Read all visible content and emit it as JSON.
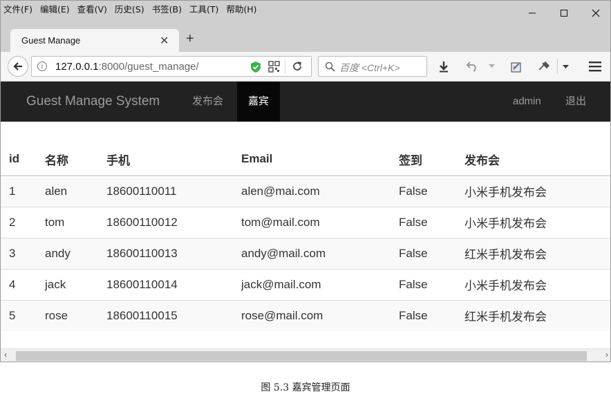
{
  "menubar": [
    "文件(F)",
    "编辑(E)",
    "查看(V)",
    "历史(S)",
    "书签(B)",
    "工具(T)",
    "帮助(H)"
  ],
  "tab": {
    "title": "Guest Manage",
    "close": "✕"
  },
  "newtab": "+",
  "address": {
    "host": "127.0.0.1",
    "port_path": ":8000/guest_manage/"
  },
  "search": {
    "placeholder": "百度 <Ctrl+K>"
  },
  "navbar": {
    "brand": "Guest Manage System",
    "links": [
      "发布会",
      "嘉宾"
    ],
    "active": "嘉宾",
    "user": "admin",
    "logout": "退出"
  },
  "table": {
    "headers": [
      "id",
      "名称",
      "手机",
      "Email",
      "签到",
      "发布会"
    ],
    "rows": [
      [
        "1",
        "alen",
        "18600110011",
        "alen@mai.com",
        "False",
        "小米手机发布会"
      ],
      [
        "2",
        "tom",
        "18600110012",
        "tom@mail.com",
        "False",
        "小米手机发布会"
      ],
      [
        "3",
        "andy",
        "18600110013",
        "andy@mail.com",
        "False",
        "红米手机发布会"
      ],
      [
        "4",
        "jack",
        "18600110014",
        "jack@mail.com",
        "False",
        "小米手机发布会"
      ],
      [
        "5",
        "rose",
        "18600110015",
        "rose@mail.com",
        "False",
        "红米手机发布会"
      ]
    ]
  },
  "caption": "图 5.3    嘉宾管理页面",
  "colors": {
    "navbar": "#222222",
    "active_bg": "#080808",
    "stripe": "#f9f9f9",
    "shield": "#3cb34a"
  },
  "icons": [
    "back-arrow-icon",
    "info-icon",
    "shield-icon",
    "qr-code-icon",
    "reload-icon",
    "search-icon",
    "download-icon",
    "undo-icon",
    "dropdown-icon",
    "clipboard-icon",
    "tools-icon",
    "hamburger-menu-icon"
  ]
}
